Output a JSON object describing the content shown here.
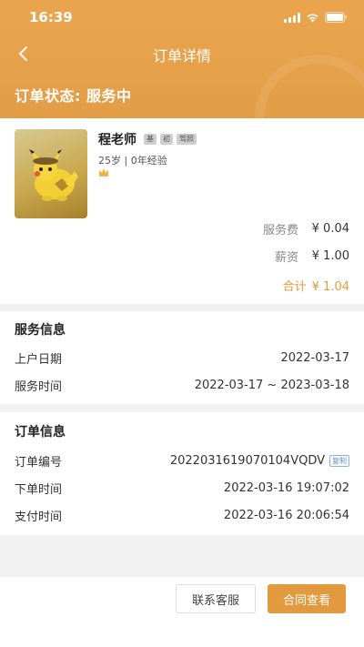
{
  "status_bar": {
    "time": "16:39"
  },
  "nav": {
    "title": "订单详情"
  },
  "order_status": "订单状态: 服务中",
  "teacher": {
    "name": "程老师",
    "tags": [
      "基",
      "初",
      "驾照"
    ],
    "meta": "25岁 | 0年经验"
  },
  "fees": {
    "service_label": "服务费",
    "service_value": "¥ 0.04",
    "salary_label": "薪资",
    "salary_value": "¥ 1.00",
    "total_label": "合计",
    "total_value": "¥ 1.04"
  },
  "service_info": {
    "title": "服务信息",
    "rows": [
      {
        "label": "上户日期",
        "value": "2022-03-17"
      },
      {
        "label": "服务时间",
        "value": "2022-03-17 ~ 2023-03-18"
      }
    ]
  },
  "order_info": {
    "title": "订单信息",
    "rows": [
      {
        "label": "订单编号",
        "value": "2022031619070104VQDV"
      },
      {
        "label": "下单时间",
        "value": "2022-03-16 19:07:02"
      },
      {
        "label": "支付时间",
        "value": "2022-03-16 20:06:54"
      }
    ],
    "copy_label": "复制"
  },
  "footer": {
    "contact_label": "联系客服",
    "contract_label": "合同查看"
  },
  "colors": {
    "accent": "#e39a3f",
    "header": "#e9a34d"
  },
  "icons": {
    "back": "chevron-left-icon",
    "crown": "crown-icon",
    "signal": "cellular-signal-icon",
    "wifi": "wifi-icon",
    "battery": "battery-icon"
  }
}
